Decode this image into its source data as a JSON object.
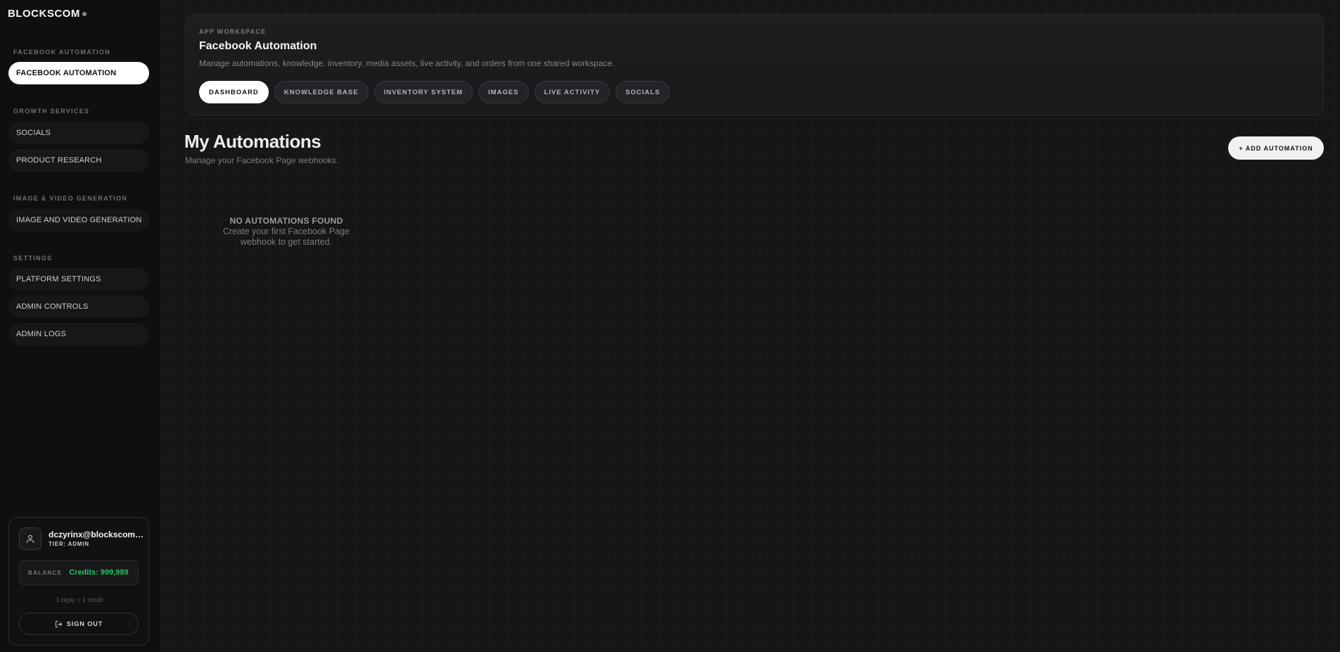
{
  "brand": {
    "name": "BLOCKSCOM"
  },
  "sidebar": {
    "sections": [
      {
        "label": "FACEBOOK AUTOMATION",
        "items": [
          {
            "label": "FACEBOOK AUTOMATION",
            "active": true
          }
        ]
      },
      {
        "label": "GROWTH SERVICES",
        "items": [
          {
            "label": "SOCIALS"
          },
          {
            "label": "PRODUCT RESEARCH"
          }
        ]
      },
      {
        "label": "IMAGE & VIDEO GENERATION",
        "items": [
          {
            "label": "IMAGE AND VIDEO GENERATION"
          }
        ]
      },
      {
        "label": "SETTINGS",
        "items": [
          {
            "label": "PLATFORM SETTINGS"
          },
          {
            "label": "ADMIN CONTROLS"
          },
          {
            "label": "ADMIN LOGS"
          }
        ]
      }
    ]
  },
  "user": {
    "email": "dczyrinx@blockscom.com",
    "tier": "TIER: ADMIN",
    "balance_label": "BALANCE",
    "balance_value": "Credits: 999,989",
    "credit_note": "1 reply = 1 credit",
    "signout_label": "SIGN OUT",
    "avatar_icon": "user-icon",
    "signout_icon": "sign-out-icon"
  },
  "workspace": {
    "kicker": "APP WORKSPACE",
    "title": "Facebook Automation",
    "description": "Manage automations, knowledge, inventory, media assets, live activity, and orders from one shared workspace.",
    "tabs": [
      {
        "label": "DASHBOARD",
        "active": true
      },
      {
        "label": "KNOWLEDGE BASE"
      },
      {
        "label": "INVENTORY SYSTEM"
      },
      {
        "label": "IMAGES"
      },
      {
        "label": "LIVE ACTIVITY"
      },
      {
        "label": "SOCIALS"
      }
    ]
  },
  "main": {
    "title": "My Automations",
    "subtitle": "Manage your Facebook Page webhooks.",
    "add_button": "+ ADD AUTOMATION",
    "empty_title": "NO AUTOMATIONS FOUND",
    "empty_desc": "Create your first Facebook Page webhook to get started."
  },
  "colors": {
    "accent_green": "#22c55e",
    "background": "#161618",
    "active_pill": "#ffffff"
  }
}
